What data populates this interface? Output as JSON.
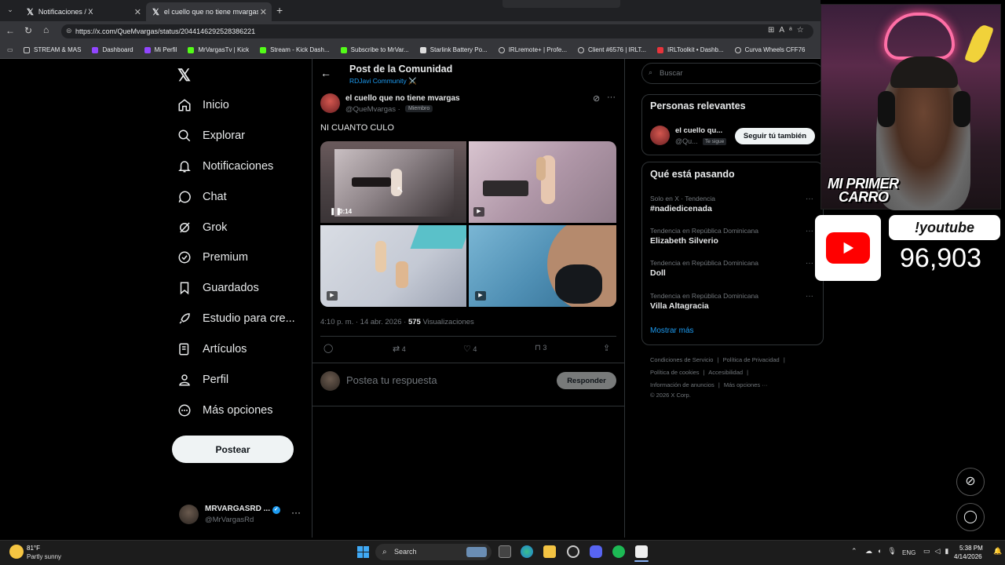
{
  "browser": {
    "tabs": [
      {
        "title": "Notificaciones / X"
      },
      {
        "title": "el cuello que no tiene mvargas en"
      }
    ],
    "url": "https://x.com/QueMvargas/status/2044146292528386221",
    "bookmarks": [
      "STREAM & MAS",
      "Dashboard",
      "Mi Perfil",
      "MrVargasTv | Kick",
      "Stream - Kick Dash...",
      "Subscribe to MrVar...",
      "Starlink Battery Po...",
      "IRLremote+ | Profe...",
      "Client #6576 | IRLT...",
      "IRLToolkit • Dashb...",
      "Curva Wheels CFF76"
    ]
  },
  "nav": {
    "items": [
      "Inicio",
      "Explorar",
      "Notificaciones",
      "Chat",
      "Grok",
      "Premium",
      "Guardados",
      "Estudio para cre...",
      "Artículos",
      "Perfil",
      "Más opciones"
    ],
    "post_button": "Postear",
    "account_name": "MRVARGASRD ...",
    "account_handle": "@MrVargasRd"
  },
  "post": {
    "header_title": "Post de la Comunidad",
    "community": "RDJavi Community ⚔️",
    "author_name": "el cuello que no tiene mvargas",
    "author_handle": "@QueMvargas",
    "member_badge": "Miembro",
    "text": "NI CUANTO CULO",
    "video_time": "0:14",
    "meta_time": "4:10 p. m. · 14 abr. 2026 · ",
    "views_count": "575",
    "views_label": "Visualizaciones",
    "retweets": "4",
    "likes": "4",
    "bookmarks": "3",
    "reply_placeholder": "Postea tu respuesta",
    "reply_button": "Responder"
  },
  "sidebar": {
    "search_placeholder": "Buscar",
    "relevant_title": "Personas relevantes",
    "relevant_name": "el cuello qu...",
    "relevant_handle": "@Qu...",
    "follows_you": "Te sigue",
    "follow_back_button": "Seguir tú también",
    "trending_title": "Qué está pasando",
    "trends": [
      {
        "label": "Solo en X · Tendencia",
        "name": "#nadiedicenada"
      },
      {
        "label": "Tendencia en República Dominicana",
        "name": "Elizabeth Silverio"
      },
      {
        "label": "Tendencia en República Dominicana",
        "name": "Doll"
      },
      {
        "label": "Tendencia en República Dominicana",
        "name": "Villa Altagracia"
      }
    ],
    "show_more": "Mostrar más",
    "footer": [
      "Condiciones de Servicio",
      "Política de Privacidad",
      "Política de cookies",
      "Accesibilidad",
      "Información de anuncios",
      "Más opciones ···",
      "© 2026 X Corp."
    ]
  },
  "overlay": {
    "banner_text_1": "MI PRIMER",
    "banner_text_2": "CARRO",
    "youtube_label": "!youtube",
    "youtube_count": "96,903"
  },
  "taskbar": {
    "temperature": "81°F",
    "weather": "Partly sunny",
    "search": "Search",
    "language": "ENG",
    "time": "5:38 PM",
    "date": "4/14/2026"
  }
}
